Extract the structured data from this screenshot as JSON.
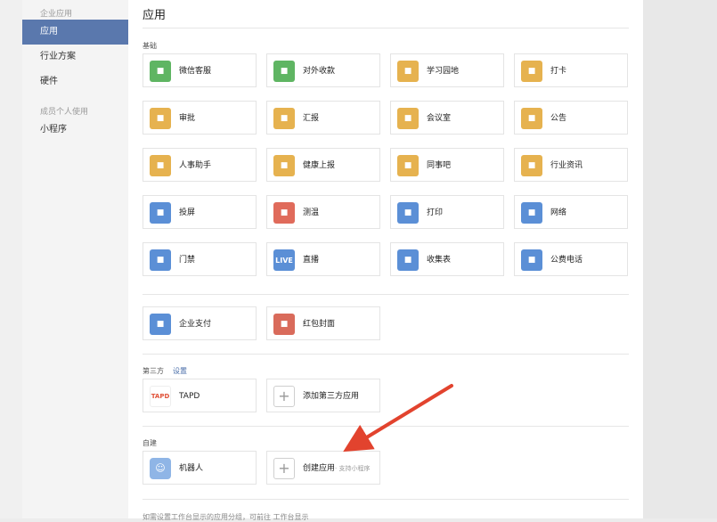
{
  "sidebar": {
    "group1": "企业应用",
    "items": [
      {
        "label": "应用",
        "active": true
      },
      {
        "label": "行业方案"
      },
      {
        "label": "硬件"
      }
    ],
    "group2": "成员个人使用",
    "items2": [
      {
        "label": "小程序"
      }
    ]
  },
  "main": {
    "title": "应用",
    "basic_label": "基础",
    "basic_apps": [
      {
        "label": "微信客服",
        "icon": "chat-icon",
        "color": "#5fb563"
      },
      {
        "label": "对外收款",
        "icon": "yuan-icon",
        "color": "#5fb563"
      },
      {
        "label": "学习园地",
        "icon": "planet-icon",
        "color": "#e6b24f"
      },
      {
        "label": "打卡",
        "icon": "location-pin-icon",
        "color": "#e6b24f"
      },
      {
        "label": "审批",
        "icon": "stamp-icon",
        "color": "#e6b24f"
      },
      {
        "label": "汇报",
        "icon": "report-icon",
        "color": "#e6b24f"
      },
      {
        "label": "会议室",
        "icon": "door-icon",
        "color": "#e6b24f"
      },
      {
        "label": "公告",
        "icon": "megaphone-icon",
        "color": "#e6b24f"
      },
      {
        "label": "人事助手",
        "icon": "person-icon",
        "color": "#e6b24f"
      },
      {
        "label": "健康上报",
        "icon": "health-icon",
        "color": "#e6b24f"
      },
      {
        "label": "同事吧",
        "icon": "network-icon",
        "color": "#e6b24f"
      },
      {
        "label": "行业资讯",
        "icon": "news-icon",
        "color": "#e6b24f"
      },
      {
        "label": "投屏",
        "icon": "screen-cast-icon",
        "color": "#5b8fd6"
      },
      {
        "label": "测温",
        "icon": "thermometer-icon",
        "color": "#e06b5b"
      },
      {
        "label": "打印",
        "icon": "printer-icon",
        "color": "#5b8fd6"
      },
      {
        "label": "网络",
        "icon": "router-icon",
        "color": "#5b8fd6"
      },
      {
        "label": "门禁",
        "icon": "access-door-icon",
        "color": "#5b8fd6"
      },
      {
        "label": "直播",
        "icon": "live-icon",
        "color": "#5b8fd6",
        "glyph": "LIVE"
      },
      {
        "label": "收集表",
        "icon": "tray-icon",
        "color": "#5b8fd6"
      },
      {
        "label": "公费电话",
        "icon": "phone-icon",
        "color": "#5b8fd6"
      }
    ],
    "pay_apps": [
      {
        "label": "企业支付",
        "icon": "payment-icon",
        "color": "#5b8fd6"
      },
      {
        "label": "红包封面",
        "icon": "red-envelope-icon",
        "color": "#d96b5b"
      }
    ],
    "third_label": "第三方",
    "third_settings": "设置",
    "third_apps": [
      {
        "label": "TAPD",
        "icon": "tapd-logo-icon",
        "glyph": "TAPD"
      },
      {
        "label": "添加第三方应用",
        "icon": "plus-icon"
      }
    ],
    "custom_label": "自建",
    "custom_apps": [
      {
        "label": "机器人",
        "icon": "robot-icon"
      },
      {
        "label": "创建应用",
        "sub": "· 支持小程序",
        "icon": "plus-icon"
      }
    ],
    "bottom_text": "如需设置工作台显示的应用分组，可前往 工作台显示"
  }
}
